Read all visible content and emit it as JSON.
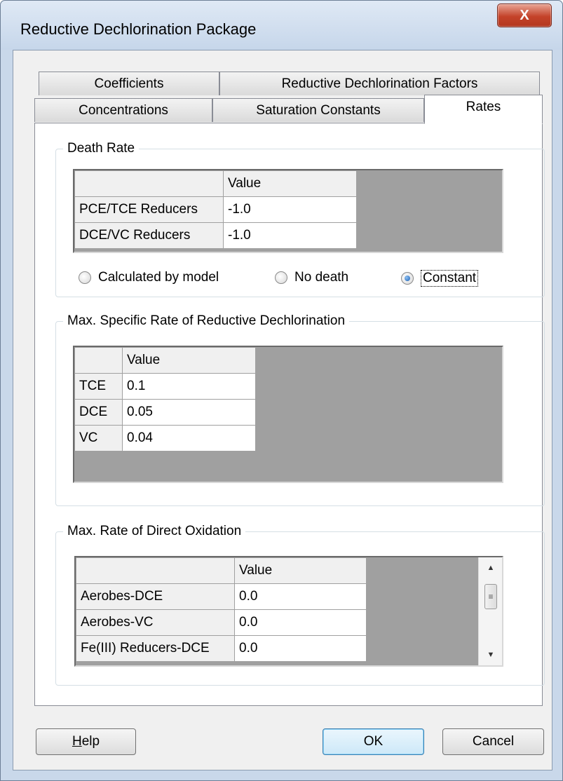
{
  "window": {
    "title": "Reductive Dechlorination Package",
    "close_glyph": "X"
  },
  "tabs": {
    "row_back": [
      "Coefficients",
      "Reductive Dechlorination Factors"
    ],
    "row_front": [
      "Concentrations",
      "Saturation Constants",
      "Rates"
    ],
    "active": "Rates"
  },
  "death_rate": {
    "label": "Death Rate",
    "column_header": "Value",
    "rows": [
      {
        "name": "PCE/TCE Reducers",
        "value": "-1.0"
      },
      {
        "name": "DCE/VC Reducers",
        "value": "-1.0"
      }
    ],
    "options": [
      "Calculated by model",
      "No death",
      "Constant"
    ],
    "selected_option": "Constant"
  },
  "max_specific_rate": {
    "label": "Max. Specific Rate of Reductive Dechlorination",
    "column_header": "Value",
    "rows": [
      {
        "name": "TCE",
        "value": "0.1"
      },
      {
        "name": "DCE",
        "value": "0.05"
      },
      {
        "name": "VC",
        "value": "0.04"
      }
    ]
  },
  "max_rate_oxidation": {
    "label": "Max. Rate of Direct Oxidation",
    "column_header": "Value",
    "rows": [
      {
        "name": "Aerobes-DCE",
        "value": "0.0"
      },
      {
        "name": "Aerobes-VC",
        "value": "0.0"
      },
      {
        "name": "Fe(III) Reducers-DCE",
        "value": "0.0"
      }
    ]
  },
  "buttons": {
    "help": "Help",
    "ok": "OK",
    "cancel": "Cancel"
  },
  "colors": {
    "grid_empty": "#a0a0a0",
    "radio_selected": "#1a5fb4",
    "close_button": "#c4432a"
  }
}
